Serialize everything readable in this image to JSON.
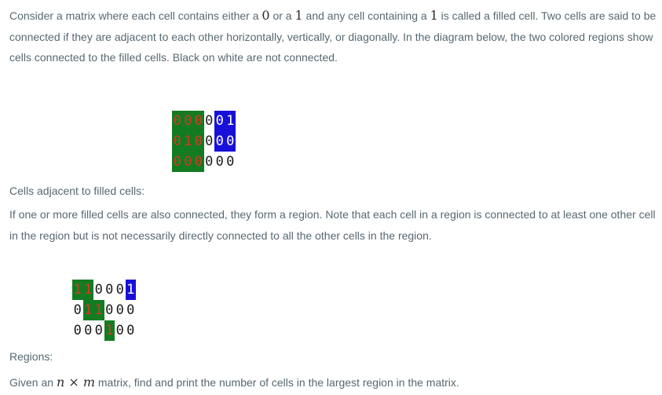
{
  "intro": {
    "segments": [
      {
        "text": "Consider a matrix where each cell contains either a ",
        "math": false
      },
      {
        "text": "0",
        "math": true
      },
      {
        "text": " or a ",
        "math": false
      },
      {
        "text": "1",
        "math": true
      },
      {
        "text": " and any cell containing a ",
        "math": false
      },
      {
        "text": "1",
        "math": true
      },
      {
        "text": " is called a filled cell. Two cells are said to be connected if they are adjacent to each other horizontally, vertically, or diagonally. In the diagram below, the two colored regions show cells connected to the filled cells. Black on white are not connected.",
        "math": false
      }
    ]
  },
  "diagram1": {
    "rows": [
      [
        {
          "v": "0",
          "bg": "green",
          "fg": "red"
        },
        {
          "v": "0",
          "bg": "green",
          "fg": "red"
        },
        {
          "v": "0",
          "bg": "green",
          "fg": "red"
        },
        {
          "v": "0",
          "bg": "none",
          "fg": "black"
        },
        {
          "v": "0",
          "bg": "blue",
          "fg": "white"
        },
        {
          "v": "1",
          "bg": "blue",
          "fg": "white"
        }
      ],
      [
        {
          "v": "0",
          "bg": "green",
          "fg": "red"
        },
        {
          "v": "1",
          "bg": "green",
          "fg": "red"
        },
        {
          "v": "0",
          "bg": "green",
          "fg": "red"
        },
        {
          "v": "0",
          "bg": "none",
          "fg": "black"
        },
        {
          "v": "0",
          "bg": "blue",
          "fg": "white"
        },
        {
          "v": "0",
          "bg": "blue",
          "fg": "white"
        }
      ],
      [
        {
          "v": "0",
          "bg": "green",
          "fg": "red"
        },
        {
          "v": "0",
          "bg": "green",
          "fg": "red"
        },
        {
          "v": "0",
          "bg": "green",
          "fg": "red"
        },
        {
          "v": "0",
          "bg": "none",
          "fg": "black"
        },
        {
          "v": "0",
          "bg": "none",
          "fg": "black"
        },
        {
          "v": "0",
          "bg": "none",
          "fg": "black"
        }
      ]
    ]
  },
  "caption1": "Cells adjacent to filled cells:",
  "regions_text": "If one or more filled cells are also connected, they form a region. Note that each cell in a region is connected to at least one other cell in the region but is not necessarily directly connected to all the other cells in the region.",
  "diagram2": {
    "rows": [
      [
        {
          "v": "1",
          "bg": "green",
          "fg": "red"
        },
        {
          "v": "1",
          "bg": "green",
          "fg": "red"
        },
        {
          "v": "0",
          "bg": "none",
          "fg": "black"
        },
        {
          "v": "0",
          "bg": "none",
          "fg": "black"
        },
        {
          "v": "0",
          "bg": "none",
          "fg": "black"
        },
        {
          "v": "1",
          "bg": "blue",
          "fg": "white"
        }
      ],
      [
        {
          "v": "0",
          "bg": "none",
          "fg": "black"
        },
        {
          "v": "1",
          "bg": "green",
          "fg": "red"
        },
        {
          "v": "1",
          "bg": "green",
          "fg": "red"
        },
        {
          "v": "0",
          "bg": "none",
          "fg": "black"
        },
        {
          "v": "0",
          "bg": "none",
          "fg": "black"
        },
        {
          "v": "0",
          "bg": "none",
          "fg": "black"
        }
      ],
      [
        {
          "v": "0",
          "bg": "none",
          "fg": "black"
        },
        {
          "v": "0",
          "bg": "none",
          "fg": "black"
        },
        {
          "v": "0",
          "bg": "none",
          "fg": "black"
        },
        {
          "v": "1",
          "bg": "green",
          "fg": "red"
        },
        {
          "v": "0",
          "bg": "none",
          "fg": "black"
        },
        {
          "v": "0",
          "bg": "none",
          "fg": "black"
        }
      ]
    ]
  },
  "caption2": "Regions:",
  "task": {
    "before": "Given an ",
    "math_n": "n",
    "math_times": " × ",
    "math_m": "m",
    "after": " matrix, find and print the number of cells in the largest region in the matrix."
  },
  "colors": {
    "text": "#576871",
    "green": "#137b22",
    "blue": "#1810d8",
    "red": "#d33a21",
    "white": "#ffffff",
    "black": "#1a1a1a"
  }
}
